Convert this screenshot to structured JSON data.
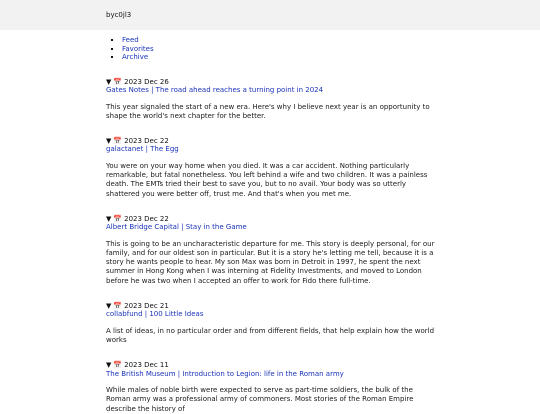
{
  "header": {
    "brand": "byc0jl3"
  },
  "nav": {
    "items": [
      "Feed",
      "Favorites",
      "Archive"
    ]
  },
  "entries": [
    {
      "toggle": "▼",
      "date": "2023 Dec 26",
      "title": "Gates Notes | The road ahead reaches a turning point in 2024",
      "summary": "This year signaled the start of a new era. Here's why I believe next year is an opportunity to shape the world's next chapter for the better."
    },
    {
      "toggle": "▼",
      "date": "2023 Dec 22",
      "title": "galactanet | The Egg",
      "summary": "You were on your way home when you died. It was a car accident. Nothing particularly remarkable, but fatal nonetheless. You left behind a wife and two children. It was a painless death. The EMTs tried their best to save you, but to no avail. Your body was so utterly shattered you were better off, trust me. And that's when you met me."
    },
    {
      "toggle": "▼",
      "date": "2023 Dec 22",
      "title": "Albert Bridge Capital | Stay in the Game",
      "summary": "This is going to be an uncharacteristic departure for me. This story is deeply personal, for our family, and for our oldest son in particular. But it is a story he's letting me tell, because it is a story he wants people to hear. My son Max was born in Detroit in 1997, he spent the next summer in Hong Kong when I was interning at Fidelity Investments, and moved to London before he was two when I accepted an offer to work for Fido there full-time."
    },
    {
      "toggle": "▼",
      "date": "2023 Dec 21",
      "title": "collabfund | 100 Little Ideas",
      "summary": "A list of ideas, in no particular order and from different fields, that help explain how the world works"
    },
    {
      "toggle": "▼",
      "date": "2023 Dec 11",
      "title": "The British Museum | Introduction to Legion: life in the Roman army",
      "summary": "While males of noble birth were expected to serve as part-time soldiers, the bulk of the Roman army was a professional army of commoners. Most stories of the Roman Empire describe the history of"
    }
  ]
}
